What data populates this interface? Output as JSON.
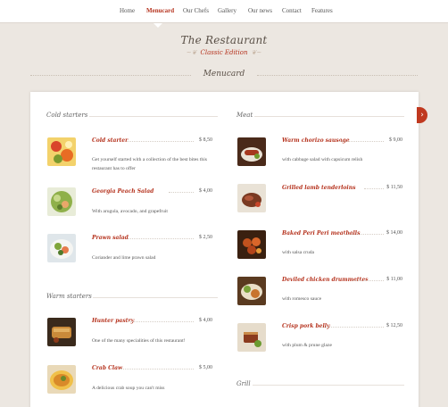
{
  "nav": {
    "items": [
      "Home",
      "Menucard",
      "Our Chefs",
      "Gallery",
      "Our news",
      "Contact",
      "Features"
    ],
    "active": "Menucard"
  },
  "logo": {
    "name": "The Restaurant",
    "tagline": "Classic Edition"
  },
  "section_title": "Menucard",
  "categories": {
    "cold_starters": "Cold starters",
    "warm_starters": "Warm starters",
    "meat": "Meat",
    "grill": "Grill"
  },
  "left_dishes": [
    {
      "name": "Cold starter",
      "price": "$ 8,50",
      "description": "Get yourself started with a collection of the best bites this restaurant has to offer",
      "image": "fruit-plate"
    },
    {
      "name": "Georgia Peach Salad",
      "price": "$ 4,00",
      "description": "With arugula, avocado, and grapefruit",
      "image": "green-salad"
    },
    {
      "name": "Prawn salad",
      "price": "$ 2,50",
      "description": "Coriander and lime prawn salad",
      "image": "prawn-salad"
    },
    {
      "name": "Hunter pastry",
      "price": "$ 4,00",
      "description": "One of the many specialities of this restaurant!",
      "image": "pastry"
    },
    {
      "name": "Crab Claw",
      "price": "$ 5,00",
      "description": "A delicious crab soup you can't miss",
      "image": "crab-soup"
    }
  ],
  "right_dishes": [
    {
      "name": "Warm chorizo sausage",
      "price": "$ 9,00",
      "description": "with cabbage salad with capsicum relish",
      "image": "chorizo"
    },
    {
      "name": "Grilled lamb tenderloins",
      "price": "$ 11,50",
      "description": "",
      "image": "lamb"
    },
    {
      "name": "Baked Peri Peri meatballs",
      "price": "$ 14,00",
      "description": "with salsa cruda",
      "image": "meatballs"
    },
    {
      "name": "Deviled chicken drummettes",
      "price": "$ 11,00",
      "description": "with romesco sauce",
      "image": "chicken"
    },
    {
      "name": "Crisp pork belly",
      "price": "$ 12,50",
      "description": "with plum & prune glaze",
      "image": "pork-belly"
    }
  ],
  "colors": {
    "accent": "#b5321d",
    "background": "#ece7e1",
    "card": "#ffffff"
  },
  "icons": {
    "next": "chevron-right-icon"
  }
}
